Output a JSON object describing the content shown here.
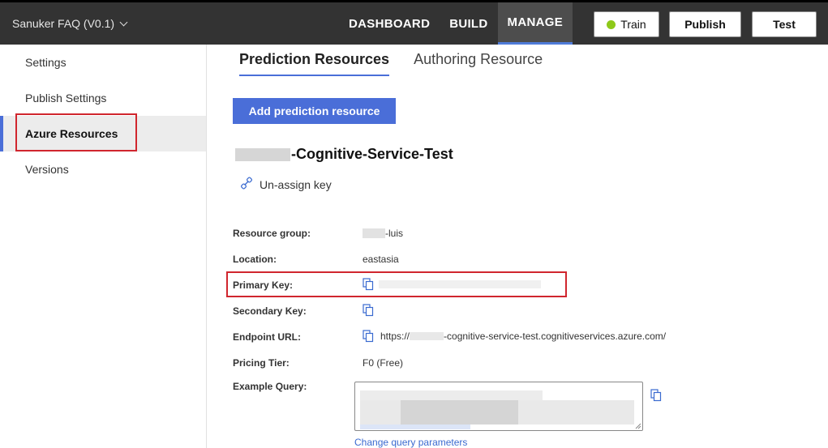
{
  "app": {
    "title": "Sanuker FAQ (V0.1)"
  },
  "nav": {
    "items": [
      "DASHBOARD",
      "BUILD",
      "MANAGE"
    ],
    "active": "MANAGE"
  },
  "toolbar": {
    "train_label": "Train",
    "publish_label": "Publish",
    "test_label": "Test",
    "train_status_color": "#8ec919"
  },
  "sidebar": {
    "items": [
      {
        "label": "Settings"
      },
      {
        "label": "Publish Settings"
      },
      {
        "label": "Azure Resources",
        "active": true
      },
      {
        "label": "Versions"
      }
    ]
  },
  "tabs": [
    {
      "label": "Prediction Resources",
      "active": true
    },
    {
      "label": "Authoring Resource"
    }
  ],
  "actions": {
    "add_label": "Add prediction resource",
    "unassign_label": "Un-assign key"
  },
  "resource": {
    "name_suffix": "-Cognitive-Service-Test",
    "properties": {
      "resource_group_label": "Resource group:",
      "resource_group_value": "-luis",
      "location_label": "Location:",
      "location_value": "eastasia",
      "primary_key_label": "Primary Key:",
      "secondary_key_label": "Secondary Key:",
      "endpoint_label": "Endpoint URL:",
      "endpoint_prefix": "https://",
      "endpoint_suffix": "-cognitive-service-test.cognitiveservices.azure.com/",
      "pricing_label": "Pricing Tier:",
      "pricing_value": "F0 (Free)",
      "example_label": "Example Query:"
    },
    "change_query_label": "Change query parameters"
  },
  "colors": {
    "accent": "#4a6ed8",
    "highlight": "#d0262e",
    "topbar": "#333333"
  }
}
